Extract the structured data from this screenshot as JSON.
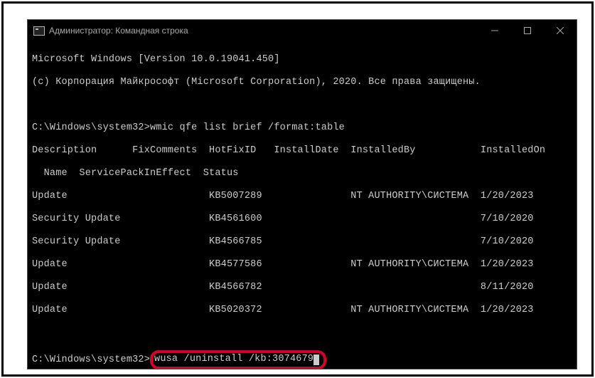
{
  "window": {
    "title": "Администратор: Командная строка"
  },
  "header": {
    "line1": "Microsoft Windows [Version 10.0.19041.450]",
    "line2": "(c) Корпорация Майкрософт (Microsoft Corporation), 2020. Все права защищены."
  },
  "prompt1": {
    "path": "C:\\Windows\\system32>",
    "cmd": "wmic qfe list brief /format:table"
  },
  "table_header": {
    "row1": "Description      FixComments  HotFixID   InstallDate  InstalledBy           InstalledOn",
    "row2": "  Name  ServicePackInEffect  Status"
  },
  "rows": [
    {
      "desc": "Update",
      "hotfix": "KB5007289",
      "by": "NT AUTHORITY\\СИСТЕМА",
      "on": "1/20/2023"
    },
    {
      "desc": "Security Update",
      "hotfix": "KB4561600",
      "by": "",
      "on": "7/10/2020"
    },
    {
      "desc": "Security Update",
      "hotfix": "KB4566785",
      "by": "",
      "on": "7/10/2020"
    },
    {
      "desc": "Update",
      "hotfix": "KB4577586",
      "by": "NT AUTHORITY\\СИСТЕМА",
      "on": "1/20/2023"
    },
    {
      "desc": "Update",
      "hotfix": "KB4566782",
      "by": "",
      "on": "8/11/2020"
    },
    {
      "desc": "Update",
      "hotfix": "KB5020372",
      "by": "NT AUTHORITY\\СИСТЕМА",
      "on": "1/20/2023"
    }
  ],
  "prompt2": {
    "path": "C:\\Windows\\system32>",
    "cmd": "wusa /uninstall /kb:3074679"
  },
  "chart_data": {
    "type": "table",
    "title": "wmic qfe list brief",
    "columns": [
      "Description",
      "FixComments",
      "HotFixID",
      "InstallDate",
      "InstalledBy",
      "InstalledOn",
      "Name",
      "ServicePackInEffect",
      "Status"
    ],
    "rows": [
      [
        "Update",
        "",
        "KB5007289",
        "",
        "NT AUTHORITY\\СИСТЕМА",
        "1/20/2023",
        "",
        "",
        ""
      ],
      [
        "Security Update",
        "",
        "KB4561600",
        "",
        "",
        "7/10/2020",
        "",
        "",
        ""
      ],
      [
        "Security Update",
        "",
        "KB4566785",
        "",
        "",
        "7/10/2020",
        "",
        "",
        ""
      ],
      [
        "Update",
        "",
        "KB4577586",
        "",
        "NT AUTHORITY\\СИСТЕМА",
        "1/20/2023",
        "",
        "",
        ""
      ],
      [
        "Update",
        "",
        "KB4566782",
        "",
        "",
        "8/11/2020",
        "",
        "",
        ""
      ],
      [
        "Update",
        "",
        "KB5020372",
        "",
        "NT AUTHORITY\\СИСТЕМА",
        "1/20/2023",
        "",
        "",
        ""
      ]
    ]
  }
}
